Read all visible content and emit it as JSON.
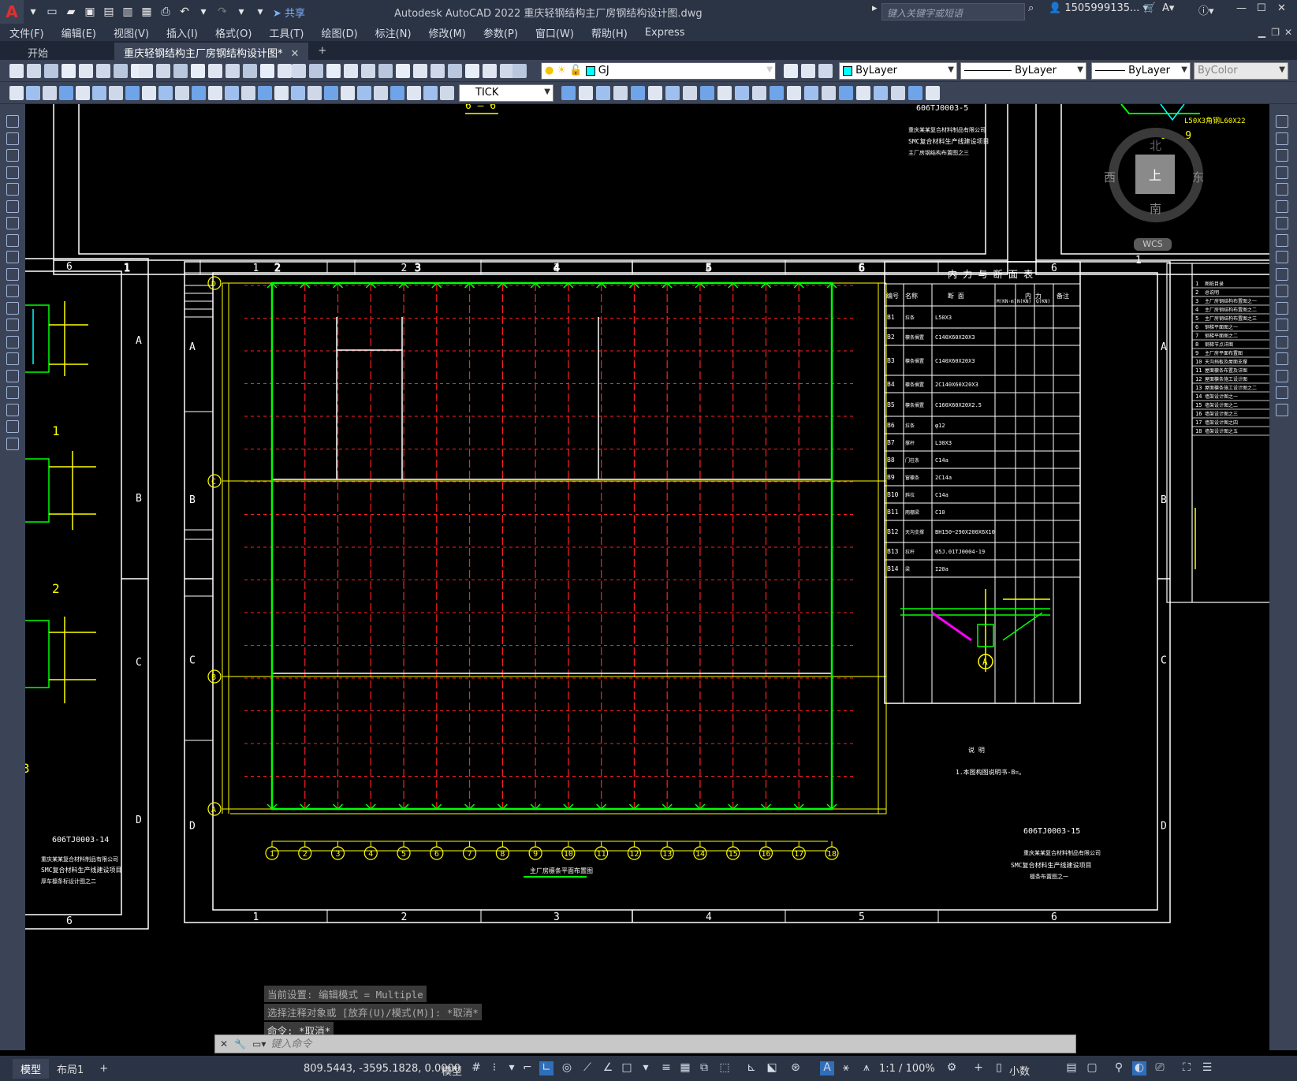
{
  "app": {
    "title": "Autodesk AutoCAD 2022    重庆轻钢结构主厂房钢结构设计图.dwg",
    "share": "共享",
    "search_placeholder": "键入关键字或短语",
    "user": "1505999135...",
    "logo": "A"
  },
  "menu": [
    "文件(F)",
    "编辑(E)",
    "视图(V)",
    "插入(I)",
    "格式(O)",
    "工具(T)",
    "绘图(D)",
    "标注(N)",
    "修改(M)",
    "参数(P)",
    "窗口(W)",
    "帮助(H)",
    "Express"
  ],
  "tabs": {
    "start": "开始",
    "doc": "重庆轻钢结构主厂房钢结构设计图*",
    "close": "✕",
    "add": "+"
  },
  "toolbar": {
    "layer": "GJ",
    "color": "ByLayer",
    "linetype": "ByLayer",
    "lineweight": "ByLayer",
    "plotstyle": "ByColor",
    "dimstyle": "TICK"
  },
  "viewcube": {
    "north": "北",
    "south": "南",
    "east": "东",
    "west": "西",
    "top": "上",
    "wcs": "WCS"
  },
  "drawing": {
    "main_number": "606TJ0003-15",
    "left_number": "606TJ0003-14",
    "top_number": "606TJ0003-5",
    "section_66": "6 — 6",
    "section_99": "9 — 9",
    "detail_label": "L50X3角钢L60X22",
    "company": "重庆某某复合材料制品有限公司",
    "project": "SMC复合材料生产线建设项目",
    "sheet_name_main": "檩条布置图之一",
    "sheet_name_left": "厚车檩条标设计图之二",
    "sheet_name_top": "主厂房钢结构布置图之三",
    "plan_title": "主厂房檩条平面布置图",
    "note_title": "说  明",
    "note_1": "1.本图构图说明书-B=。",
    "left_labels": [
      "1",
      "2",
      "3"
    ],
    "column_numbers": [
      "1",
      "2",
      "3",
      "4",
      "5",
      "6"
    ],
    "row_letters": [
      "A",
      "B",
      "C",
      "D"
    ],
    "axis_numbers": [
      "1",
      "2",
      "3",
      "4",
      "5",
      "6",
      "7",
      "8",
      "9",
      "10",
      "11",
      "12",
      "13",
      "14",
      "15",
      "16",
      "17",
      "18"
    ],
    "axis_letters": [
      "D",
      "C",
      "B",
      "A"
    ],
    "table": {
      "title": "内 力 与 断 面 表",
      "headers": [
        "编号",
        "名称",
        "断    面",
        "内  力",
        "备注"
      ],
      "sub_headers": [
        "M(KN·m)",
        "N(KN)",
        "Q(KN)"
      ],
      "rows": [
        [
          "B1",
          "拉条",
          "L50X3"
        ],
        [
          "B2",
          "檩条搁置",
          "C140X60X20X3"
        ],
        [
          "B3",
          "檩条搁置",
          "C140X60X20X3"
        ],
        [
          "B4",
          "檩条搁置",
          "2C140X60X20X3"
        ],
        [
          "B5",
          "檩条搁置",
          "C160X60X20X2.5"
        ],
        [
          "B6",
          "拉条",
          "φ12"
        ],
        [
          "B7",
          "撑杆",
          "L30X3"
        ],
        [
          "B8",
          "门柱条",
          "C14a"
        ],
        [
          "B9",
          "窗檩条",
          "2C14a"
        ],
        [
          "B10",
          "斜拉",
          "C14a"
        ],
        [
          "B11",
          "雨棚梁",
          "C10"
        ],
        [
          "B12",
          "天沟支撑",
          "BH150~290X200X6X10"
        ],
        [
          "B13",
          "拉杆",
          "05J.01TJ0004-19"
        ],
        [
          "B14",
          "梁",
          "I20a"
        ]
      ]
    },
    "right_list": [
      "图纸目录",
      "总说明",
      "主厂房钢结构布置图之一",
      "主厂房钢结构布置图之二",
      "主厂房钢结构布置图之三",
      "钢梯平面图之一",
      "钢梯平面图之二",
      "钢梯节点详图",
      "主厂房平面布置图",
      "天沟挡板及屋面支撑",
      "屋面檩条布置及详图",
      "屋面檩条施工设计图",
      "屋面檩条施工设计图之二",
      "墙架设计图之一",
      "墙架设计图之二",
      "墙架设计图之三",
      "墙架设计图之四",
      "墙架设计图之五"
    ]
  },
  "command": {
    "history": [
      "当前设置: 编辑模式 = Multiple",
      "选择注释对象或 [放弃(U)/模式(M)]: *取消*",
      "命令: *取消*"
    ],
    "placeholder": "键入命令"
  },
  "status": {
    "tab_model": "模型",
    "tab_layout": "布局1",
    "add": "+",
    "coords": "809.5443, -3595.1828, 0.0000",
    "space": "模型",
    "scale": "1:1 / 100%",
    "units": "小数"
  },
  "colors": {
    "titlebar": "#2b3445",
    "toolbar": "#3b4457",
    "canvas": "#000000",
    "frame": "#ffffff",
    "yellow": "#ffff00",
    "green": "#00ff00",
    "red": "#ff0000"
  }
}
